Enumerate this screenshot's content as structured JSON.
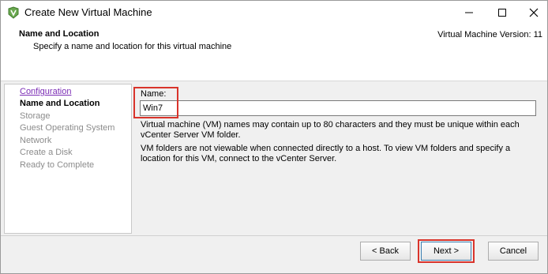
{
  "window": {
    "title": "Create New Virtual Machine",
    "controls": [
      "minimize",
      "maximize",
      "close"
    ]
  },
  "header": {
    "title": "Name and Location",
    "subtitle": "Specify a name and location for this virtual machine",
    "version": "Virtual Machine Version: 11"
  },
  "nav": {
    "items": [
      {
        "label": "Configuration",
        "state": "link"
      },
      {
        "label": "Name and Location",
        "state": "current"
      },
      {
        "label": "Storage",
        "state": "disabled"
      },
      {
        "label": "Guest Operating System",
        "state": "disabled"
      },
      {
        "label": "Network",
        "state": "disabled"
      },
      {
        "label": "Create a Disk",
        "state": "disabled"
      },
      {
        "label": "Ready to Complete",
        "state": "disabled"
      }
    ]
  },
  "form": {
    "name_label": "Name:",
    "name_value": "Win7",
    "help_text_1": "Virtual machine (VM) names may contain up to 80 characters and they must be unique within each vCenter Server VM folder.",
    "help_text_2": "VM folders are not viewable when connected directly to a host. To view VM folders and specify a location for this VM, connect to the vCenter Server."
  },
  "footer": {
    "back_label": "< Back",
    "next_label": "Next >",
    "cancel_label": "Cancel"
  },
  "colors": {
    "highlight": "#d9342b",
    "link": "#7b2db5",
    "disabled_text": "#8c8c8c",
    "icon_green": "#6aa84f"
  }
}
